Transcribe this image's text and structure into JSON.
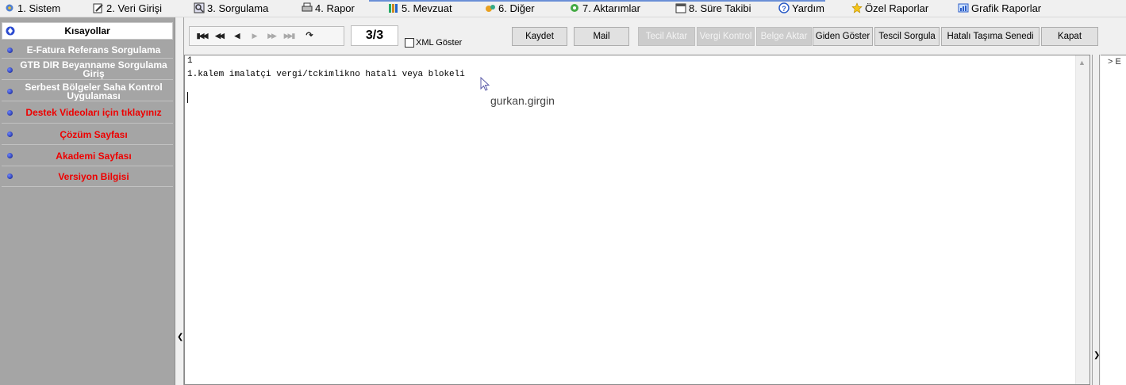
{
  "menubar": {
    "items": [
      {
        "label": "1.  Sistem",
        "icon": "gear-icon"
      },
      {
        "label": "2.  Veri Girişi",
        "icon": "edit-icon"
      },
      {
        "label": "3.  Sorgulama",
        "icon": "search-icon"
      },
      {
        "label": "4.  Rapor",
        "icon": "printer-icon"
      },
      {
        "label": "5.  Mevzuat",
        "icon": "books-icon"
      },
      {
        "label": "6.  Diğer",
        "icon": "tools-icon"
      },
      {
        "label": "7.  Aktarımlar",
        "icon": "transfer-icon"
      },
      {
        "label": "8. Süre Takibi",
        "icon": "calendar-icon"
      },
      {
        "label": "Yardım",
        "icon": "help-icon"
      },
      {
        "label": "Özel Raporlar",
        "icon": "star-icon"
      },
      {
        "label": "Grafik Raporlar",
        "icon": "chart-icon"
      }
    ]
  },
  "sidebar": {
    "header": "Kısayollar",
    "items": [
      {
        "label": "E-Fatura Referans Sorgulama",
        "color": "#ffffff"
      },
      {
        "label": "GTB DIR Beyanname Sorgulama Giriş",
        "color": "#ffffff"
      },
      {
        "label": "Serbest Bölgeler Saha Kontrol Uygulaması",
        "color": "#ffffff"
      },
      {
        "label": "Destek Videoları için tıklayınız",
        "color": "#ee0000"
      },
      {
        "label": "Çözüm Sayfası",
        "color": "#ee0000"
      },
      {
        "label": "Akademi Sayfası",
        "color": "#ee0000"
      },
      {
        "label": "Versiyon Bilgisi",
        "color": "#ee0000"
      }
    ]
  },
  "toolbar": {
    "counter": "3/3",
    "xml_label": "XML Göster",
    "buttons": [
      {
        "label": "Kaydet",
        "enabled": true
      },
      {
        "label": "Mail",
        "enabled": true
      },
      {
        "label": "Tecil Aktar",
        "enabled": false
      },
      {
        "label": "Vergi Kontrol",
        "enabled": false
      },
      {
        "label": "Belge Aktar",
        "enabled": false
      },
      {
        "label": "Giden Göster",
        "enabled": true
      },
      {
        "label": "Tescil Sorgula",
        "enabled": true
      },
      {
        "label": "Hatalı Taşıma Senedi",
        "enabled": true
      },
      {
        "label": "Kapat",
        "enabled": true
      }
    ]
  },
  "editor": {
    "line1": "1",
    "line2": "1.kalem imalatçi vergi/tckimlikno hatali veya blokeli"
  },
  "tooltip": {
    "user": "gurkan.girgin"
  },
  "right_panel": {
    "node_label": "E"
  }
}
